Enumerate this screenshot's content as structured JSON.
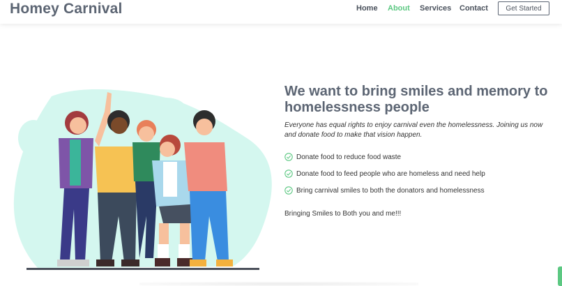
{
  "header": {
    "logo": "Homey Carnival",
    "nav": [
      {
        "label": "Home",
        "active": false
      },
      {
        "label": "About",
        "active": true
      },
      {
        "label": "Services",
        "active": false
      },
      {
        "label": "Contact",
        "active": false
      }
    ],
    "cta_label": "Get Started"
  },
  "about": {
    "heading": "We want to bring smiles and memory to homelessness people",
    "lead": "Everyone has equal rights to enjoy carnival even the homelessness. Joining us now and donate food to make that vision happen.",
    "features": [
      {
        "icon": "check-circle-icon",
        "text": "Donate food to reduce food waste"
      },
      {
        "icon": "check-circle-icon",
        "text": "Donate food to feed people who are homeless and need help"
      },
      {
        "icon": "check-circle-icon",
        "text": "Bring carnival smiles to both the donators and homelessness"
      }
    ],
    "tagline": "Bringing Smiles to Both you and me!!!",
    "illustration": "group-of-friends-illustration"
  },
  "colors": {
    "accent": "#5cc882",
    "title": "#5c6573",
    "blob": "#d4f7ef"
  }
}
